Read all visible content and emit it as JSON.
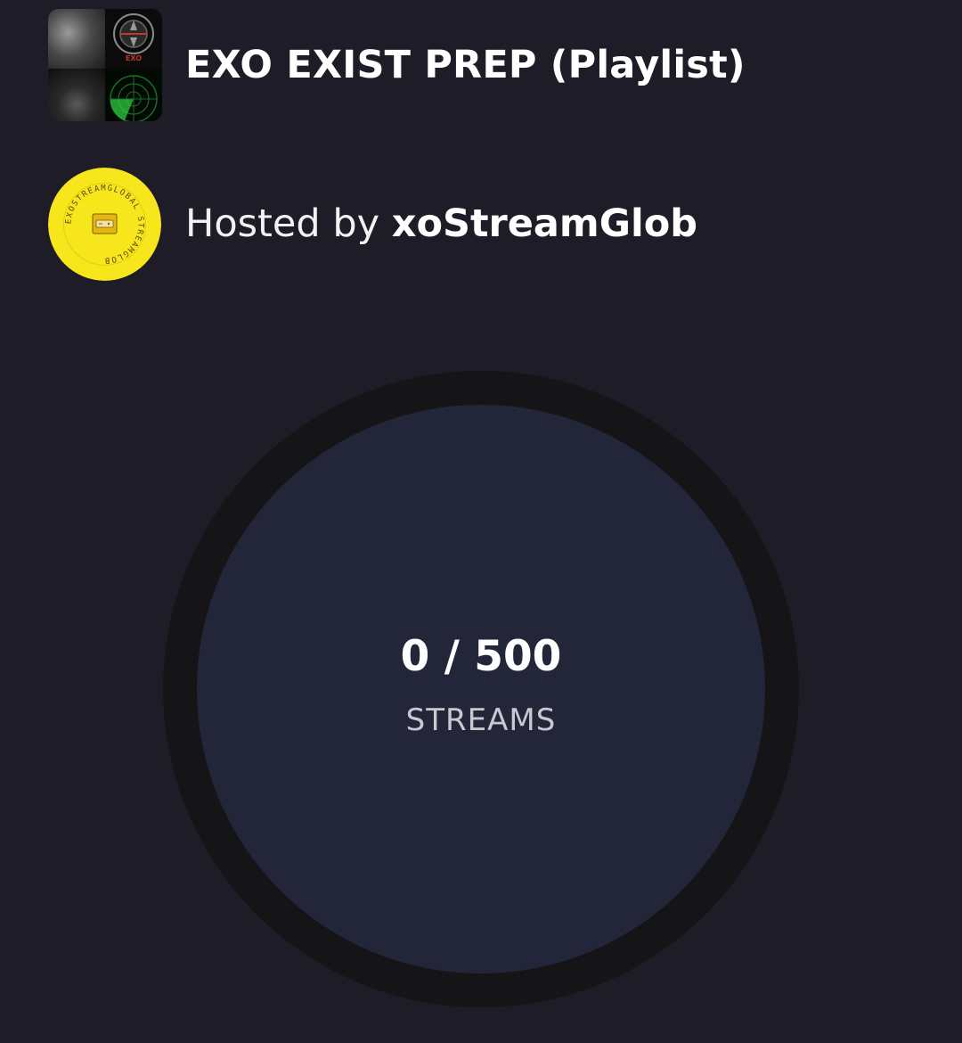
{
  "playlist": {
    "title": "EXO EXIST PREP (Playlist)",
    "cover_label": "EXO"
  },
  "host": {
    "prefix": "Hosted by ",
    "name": "xoStreamGlob",
    "avatar_ring_text": "EXOSTREAMGLOBAL STREAMGLOB"
  },
  "progress": {
    "current": 0,
    "goal": 500,
    "count_text": "0 / 500",
    "label": "STREAMS",
    "ring_color": "#151518",
    "fill_color": "#232638"
  },
  "colors": {
    "background": "#1e1c26",
    "avatar_yellow": "#f7e61c"
  }
}
